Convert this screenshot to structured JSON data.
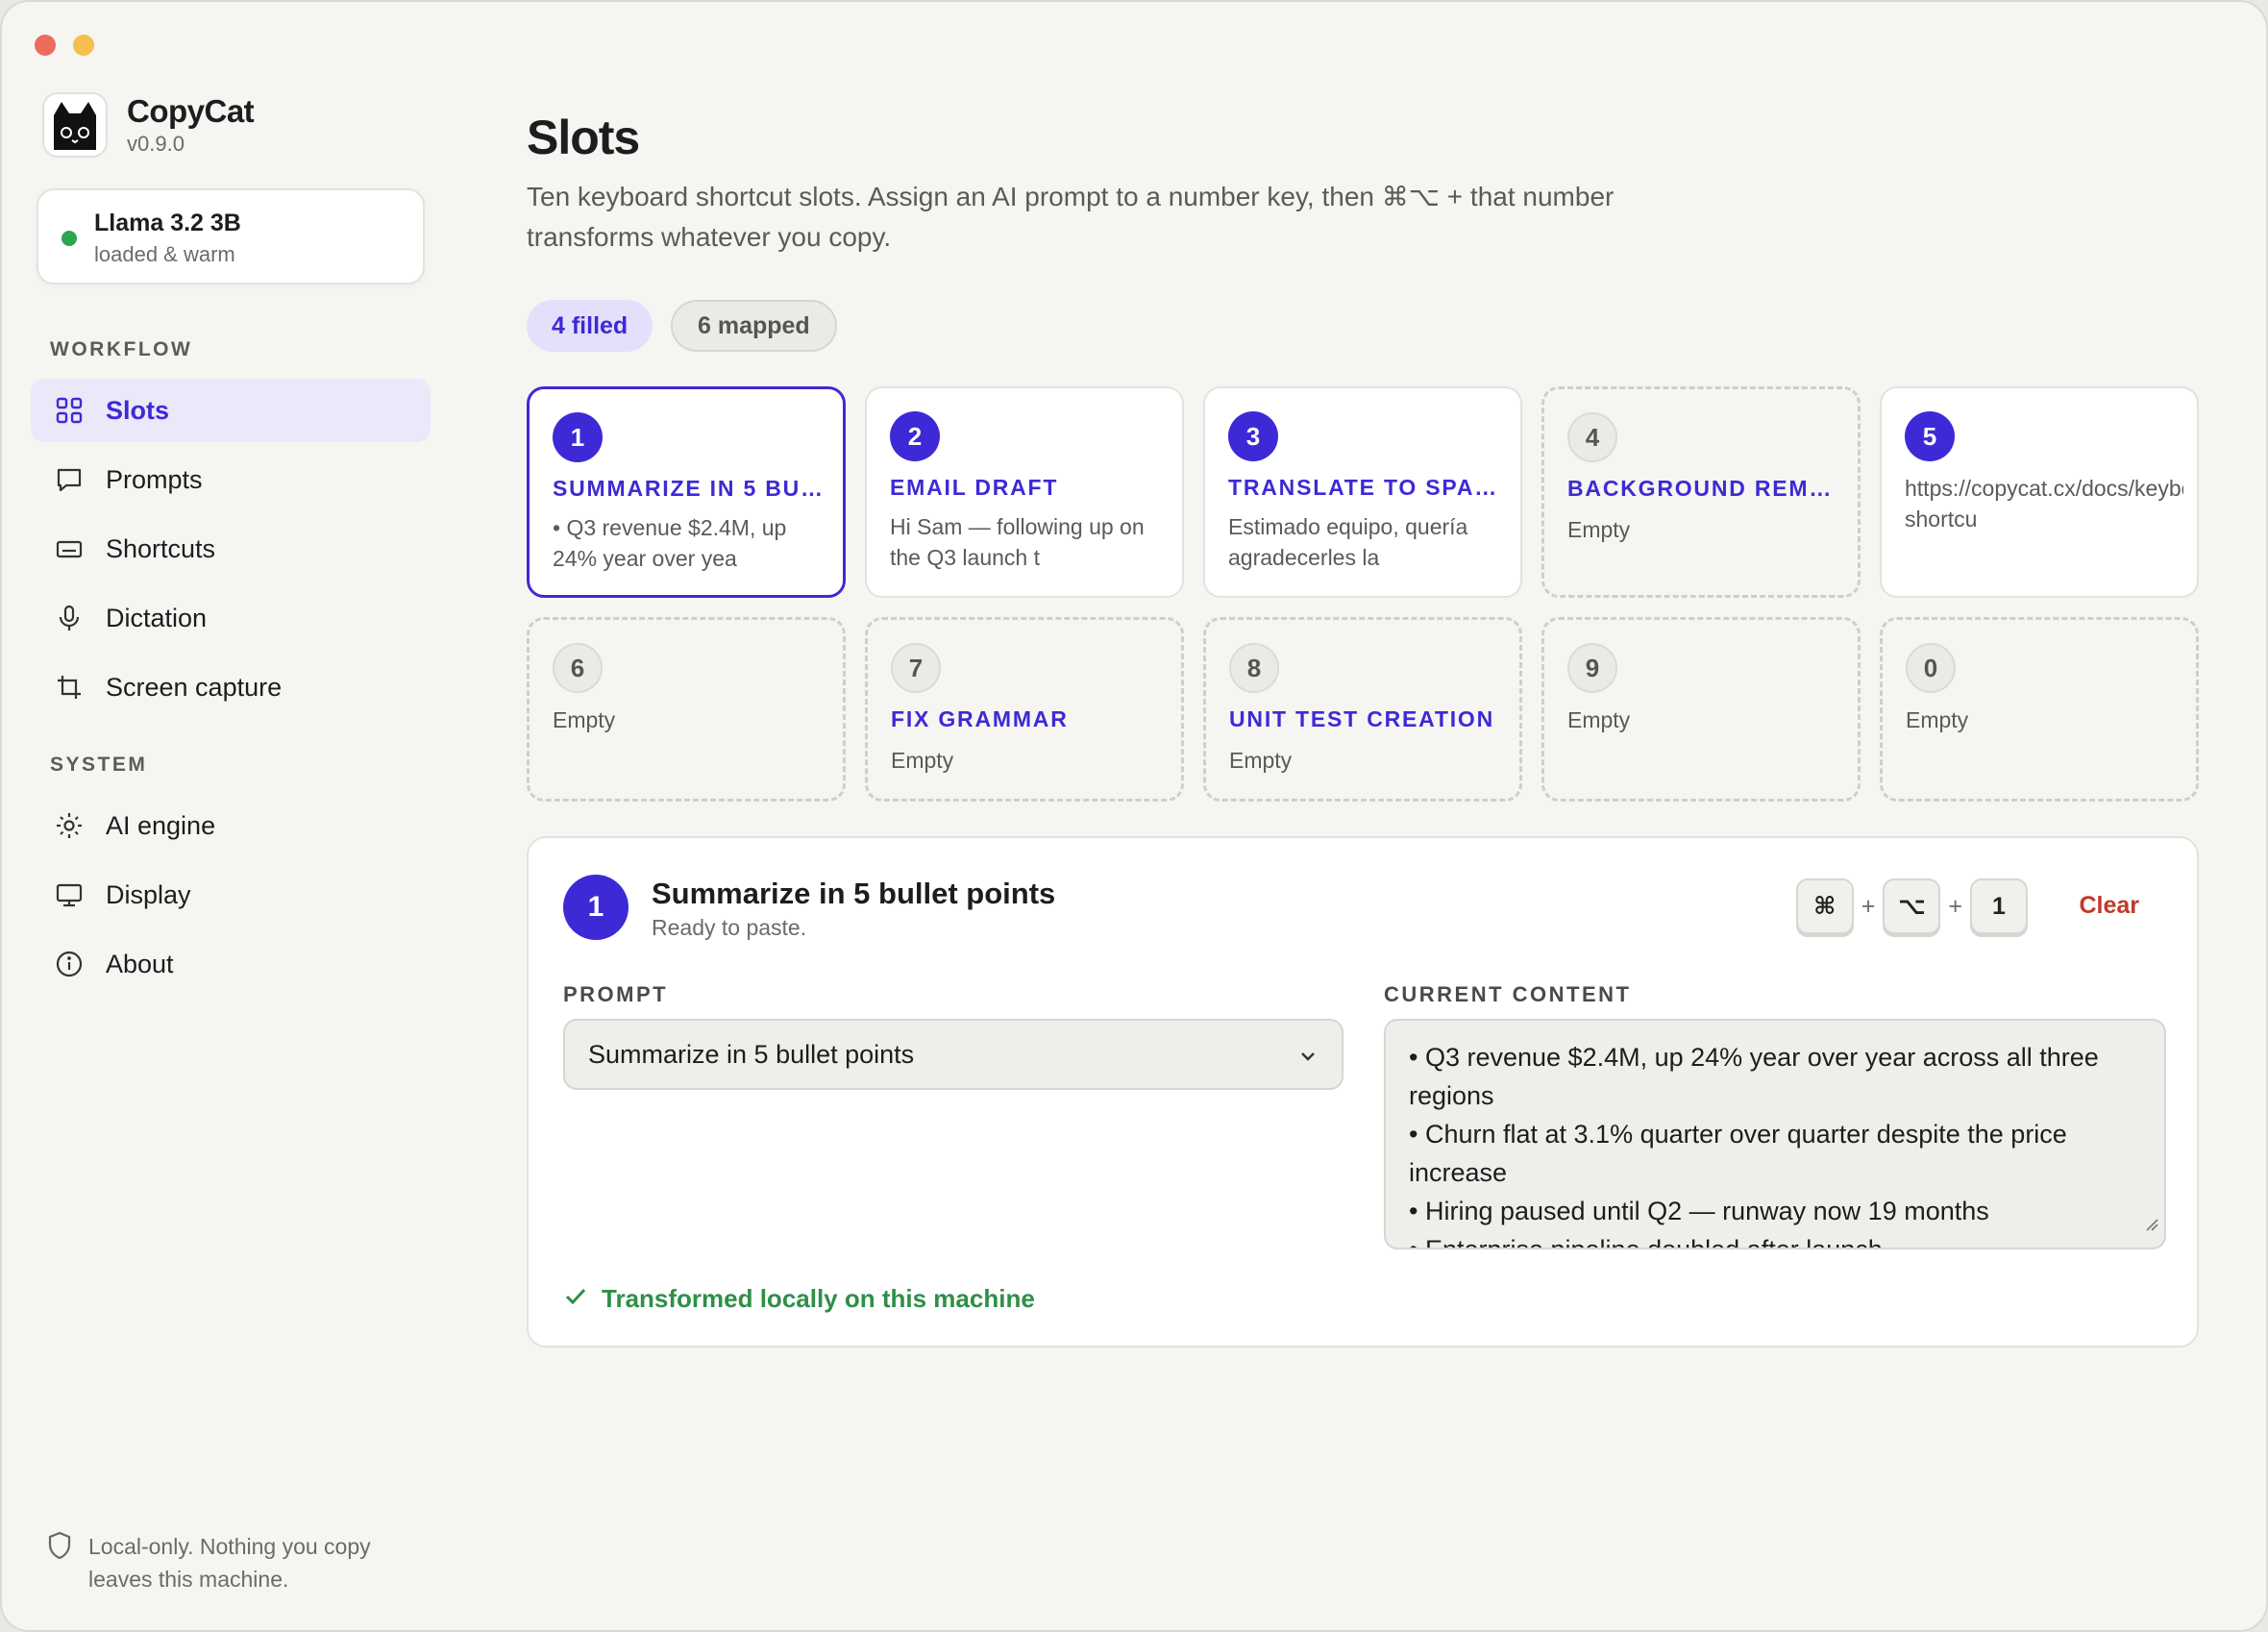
{
  "app": {
    "name": "CopyCat",
    "version": "v0.9.0"
  },
  "model": {
    "name": "Llama 3.2 3B",
    "status": "loaded & warm",
    "status_color": "#2da44e"
  },
  "sidebar": {
    "workflow_label": "WORKFLOW",
    "system_label": "SYSTEM",
    "workflow_items": [
      {
        "label": "Slots",
        "icon": "grid-icon",
        "active": true
      },
      {
        "label": "Prompts",
        "icon": "chat-bubble-icon"
      },
      {
        "label": "Shortcuts",
        "icon": "keyboard-icon"
      },
      {
        "label": "Dictation",
        "icon": "microphone-icon"
      },
      {
        "label": "Screen capture",
        "icon": "crop-icon"
      }
    ],
    "system_items": [
      {
        "label": "AI engine",
        "icon": "sun-icon"
      },
      {
        "label": "Display",
        "icon": "monitor-icon"
      },
      {
        "label": "About",
        "icon": "info-icon"
      }
    ],
    "footer_note": "Local-only. Nothing you copy leaves this machine."
  },
  "page": {
    "title": "Slots",
    "subtitle": "Ten keyboard shortcut slots. Assign an AI prompt to a number key, then ⌘⌥ + that number transforms whatever you copy.",
    "pill_filled": "4 filled",
    "pill_mapped": "6 mapped"
  },
  "slots": [
    {
      "num": "1",
      "title": "SUMMARIZE IN 5 BU…",
      "body": "• Q3 revenue $2.4M, up 24% year over yea",
      "state": "filled"
    },
    {
      "num": "2",
      "title": "EMAIL DRAFT",
      "body": "Hi Sam — following up on the Q3 launch t",
      "state": "filled"
    },
    {
      "num": "3",
      "title": "TRANSLATE TO SPA…",
      "body": "Estimado equipo, quería agradecerles la",
      "state": "filled"
    },
    {
      "num": "4",
      "title": "BACKGROUND REMO…",
      "body": "Empty",
      "state": "mapped"
    },
    {
      "num": "5",
      "title": "",
      "body": "https://copycat.cx/docs/keyboard-\nshortcu",
      "state": "filled"
    },
    {
      "num": "6",
      "title": "",
      "body": "Empty",
      "state": "empty"
    },
    {
      "num": "7",
      "title": "FIX GRAMMAR",
      "body": "Empty",
      "state": "mapped"
    },
    {
      "num": "8",
      "title": "UNIT TEST CREATION",
      "body": "Empty",
      "state": "mapped"
    },
    {
      "num": "9",
      "title": "",
      "body": "Empty",
      "state": "empty"
    },
    {
      "num": "0",
      "title": "",
      "body": "Empty",
      "state": "empty"
    }
  ],
  "detail": {
    "num": "1",
    "title": "Summarize in 5 bullet points",
    "status": "Ready to paste.",
    "keys": [
      "⌘",
      "⌥",
      "1"
    ],
    "plus": "+",
    "clear_label": "Clear",
    "prompt_label": "PROMPT",
    "prompt_value": "Summarize in 5 bullet points",
    "content_label": "CURRENT CONTENT",
    "content_lines": [
      "• Q3 revenue $2.4M, up 24% year over year across all three regions",
      "• Churn flat at 3.1% quarter over quarter despite the price increase",
      "• Hiring paused until Q2 — runway now 19 months",
      "• Enterprise pipeline doubled after launch"
    ],
    "ok_text": "Transformed locally on this machine"
  },
  "colors": {
    "accent": "#3d2ad6",
    "success": "#2f8f48",
    "danger": "#c0392b"
  }
}
